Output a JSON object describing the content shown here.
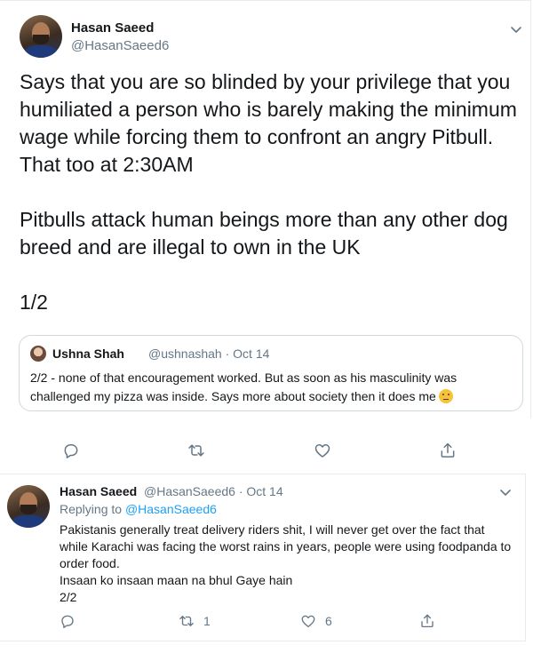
{
  "tweet": {
    "author_name": "Hasan Saeed",
    "author_handle": "@HasanSaeed6",
    "text": "Says that you are so blinded by your privilege that you humiliated a person who is barely making the minimum wage while forcing them to confront an angry Pitbull. That too at 2:30AM\n\nPitbulls attack human beings more than any other dog breed and are illegal to own in the UK\n\n1/2",
    "quoted": {
      "author_name": "Ushna Shah",
      "meta": "@ushnashah · Oct 14",
      "text": "2/2 - none of that encouragement worked. But as soon as his masculinity was challenged my pizza was inside. Says more about society then it does me",
      "emoji": "face-with-raised-eyebrow"
    },
    "actions": {
      "reply_icon": "reply-icon",
      "retweet_icon": "retweet-icon",
      "like_icon": "like-icon",
      "share_icon": "share-icon"
    }
  },
  "reply": {
    "author_name": "Hasan Saeed",
    "meta": "@HasanSaeed6 · Oct 14",
    "replying_prefix": "Replying to",
    "replying_handle": "@HasanSaeed6",
    "text": "Pakistanis generally treat delivery riders shit, I will never get over the fact that while Karachi was facing the worst rains in years, people were using foodpanda to order food.\nInsaan ko insaan maan na bhul Gaye hain\n2/2",
    "retweet_count": "1",
    "like_count": "6"
  },
  "colors": {
    "text": "#14171a",
    "secondary": "#657786",
    "link": "#1da1f2",
    "border": "#e6ecf0"
  }
}
